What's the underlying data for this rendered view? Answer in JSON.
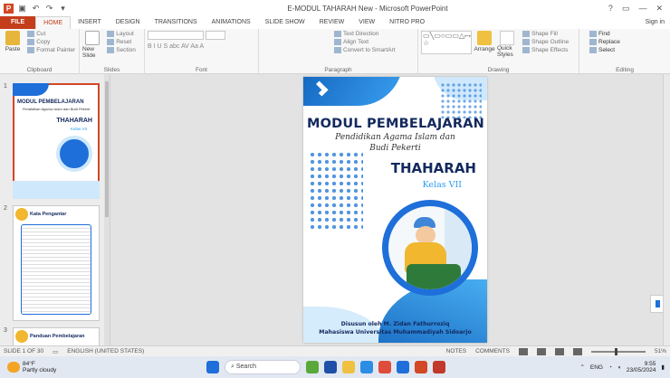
{
  "window": {
    "title": "E-MODUL TAHARAH New - Microsoft PowerPoint",
    "controls": [
      "?",
      "▭",
      "—",
      "✕"
    ]
  },
  "ribbon": {
    "tabs": [
      "FILE",
      "HOME",
      "INSERT",
      "DESIGN",
      "TRANSITIONS",
      "ANIMATIONS",
      "SLIDE SHOW",
      "REVIEW",
      "VIEW",
      "NITRO PRO"
    ],
    "active_tab": "HOME",
    "sign_in": "Sign in",
    "clipboard": {
      "paste": "Paste",
      "cut": "Cut",
      "copy": "Copy",
      "format_painter": "Format Painter",
      "label": "Clipboard"
    },
    "slides": {
      "new_slide": "New Slide",
      "layout": "Layout",
      "reset": "Reset",
      "section": "Section",
      "label": "Slides"
    },
    "font": {
      "label": "Font",
      "format_glyphs": "B I U S abc AV Aa A"
    },
    "paragraph": {
      "text_direction": "Text Direction",
      "align_text": "Align Text",
      "convert_smartart": "Convert to SmartArt",
      "label": "Paragraph"
    },
    "drawing": {
      "arrange": "Arrange",
      "quick_styles": "Quick Styles",
      "shape_fill": "Shape Fill",
      "shape_outline": "Shape Outline",
      "shape_effects": "Shape Effects",
      "label": "Drawing"
    },
    "editing": {
      "find": "Find",
      "replace": "Replace",
      "select": "Select",
      "label": "Editing"
    }
  },
  "thumbnails": [
    {
      "number": "1",
      "title": "MODUL PEMBELAJARAN",
      "subtitle": "Pendidikan Agama Islam dan Budi Pekerti",
      "heading": "THAHARAH",
      "sub": "Kelas VII"
    },
    {
      "number": "2",
      "title": "Kata Pengantar"
    },
    {
      "number": "3",
      "title": "Panduan Pembelajaran"
    }
  ],
  "slide": {
    "title": "MODUL PEMBELAJARAN",
    "subtitle_line1": "Pendidikan Agama Islam dan",
    "subtitle_line2": "Budi Pekerti",
    "heading": "THAHARAH",
    "class": "Kelas VII",
    "credit_line1": "Disusun oleh M. Zidan Fathurroziq",
    "credit_line2": "Mahasiswa Universitas Muhammadiyah Sidoarjo"
  },
  "statusbar": {
    "slide_info": "SLIDE 1 OF 30",
    "language": "ENGLISH (UNITED STATES)",
    "notes": "NOTES",
    "comments": "COMMENTS",
    "zoom": "51%"
  },
  "taskbar": {
    "temperature": "84°F",
    "weather": "Partly cloudy",
    "search": "Search",
    "language": "ENG",
    "time": "9:55",
    "date": "23/05/2024"
  },
  "colors": {
    "accent": "#c43e1c",
    "slide_navy": "#13295e",
    "slide_blue": "#1e6fd9",
    "slide_light_blue": "#2a9df4"
  }
}
